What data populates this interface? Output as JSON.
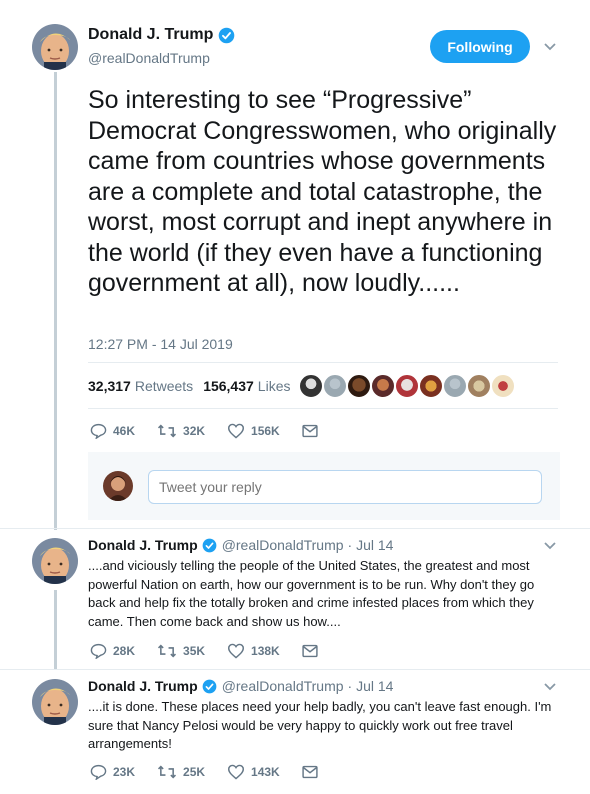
{
  "main_tweet": {
    "author_name": "Donald J. Trump",
    "handle": "@realDonaldTrump",
    "follow_label": "Following",
    "text": "So interesting to see “Progressive” Democrat Congresswomen, who originally came from countries whose governments are a complete and total catastrophe, the worst, most corrupt and inept anywhere in the world (if they even have a functioning government at all), now loudly......",
    "timestamp": "12:27 PM - 14 Jul 2019",
    "retweets_count": "32,317",
    "retweets_label": "Retweets",
    "likes_count": "156,437",
    "likes_label": "Likes",
    "actions": {
      "replies": "46K",
      "retweets": "32K",
      "likes": "156K"
    }
  },
  "reply_box": {
    "placeholder": "Tweet your reply"
  },
  "thread": [
    {
      "author_name": "Donald J. Trump",
      "handle": "@realDonaldTrump",
      "date": "· Jul 14",
      "text": "....and viciously telling the people of the United States, the greatest and most powerful Nation on earth, how our government is to be run. Why don't they go back and help fix the totally broken and crime infested places from which they came. Then come back and show us how....",
      "actions": {
        "replies": "28K",
        "retweets": "35K",
        "likes": "138K"
      }
    },
    {
      "author_name": "Donald J. Trump",
      "handle": "@realDonaldTrump",
      "date": "· Jul 14",
      "text": "....it is done. These places need your help badly, you can't leave fast enough. I'm sure that Nancy Pelosi would be very happy to quickly work out free travel arrangements!",
      "actions": {
        "replies": "23K",
        "retweets": "25K",
        "likes": "143K"
      }
    }
  ],
  "colors": {
    "accent": "#1da1f2",
    "muted": "#657786",
    "text": "#14171a",
    "like_heart": "#657786"
  }
}
